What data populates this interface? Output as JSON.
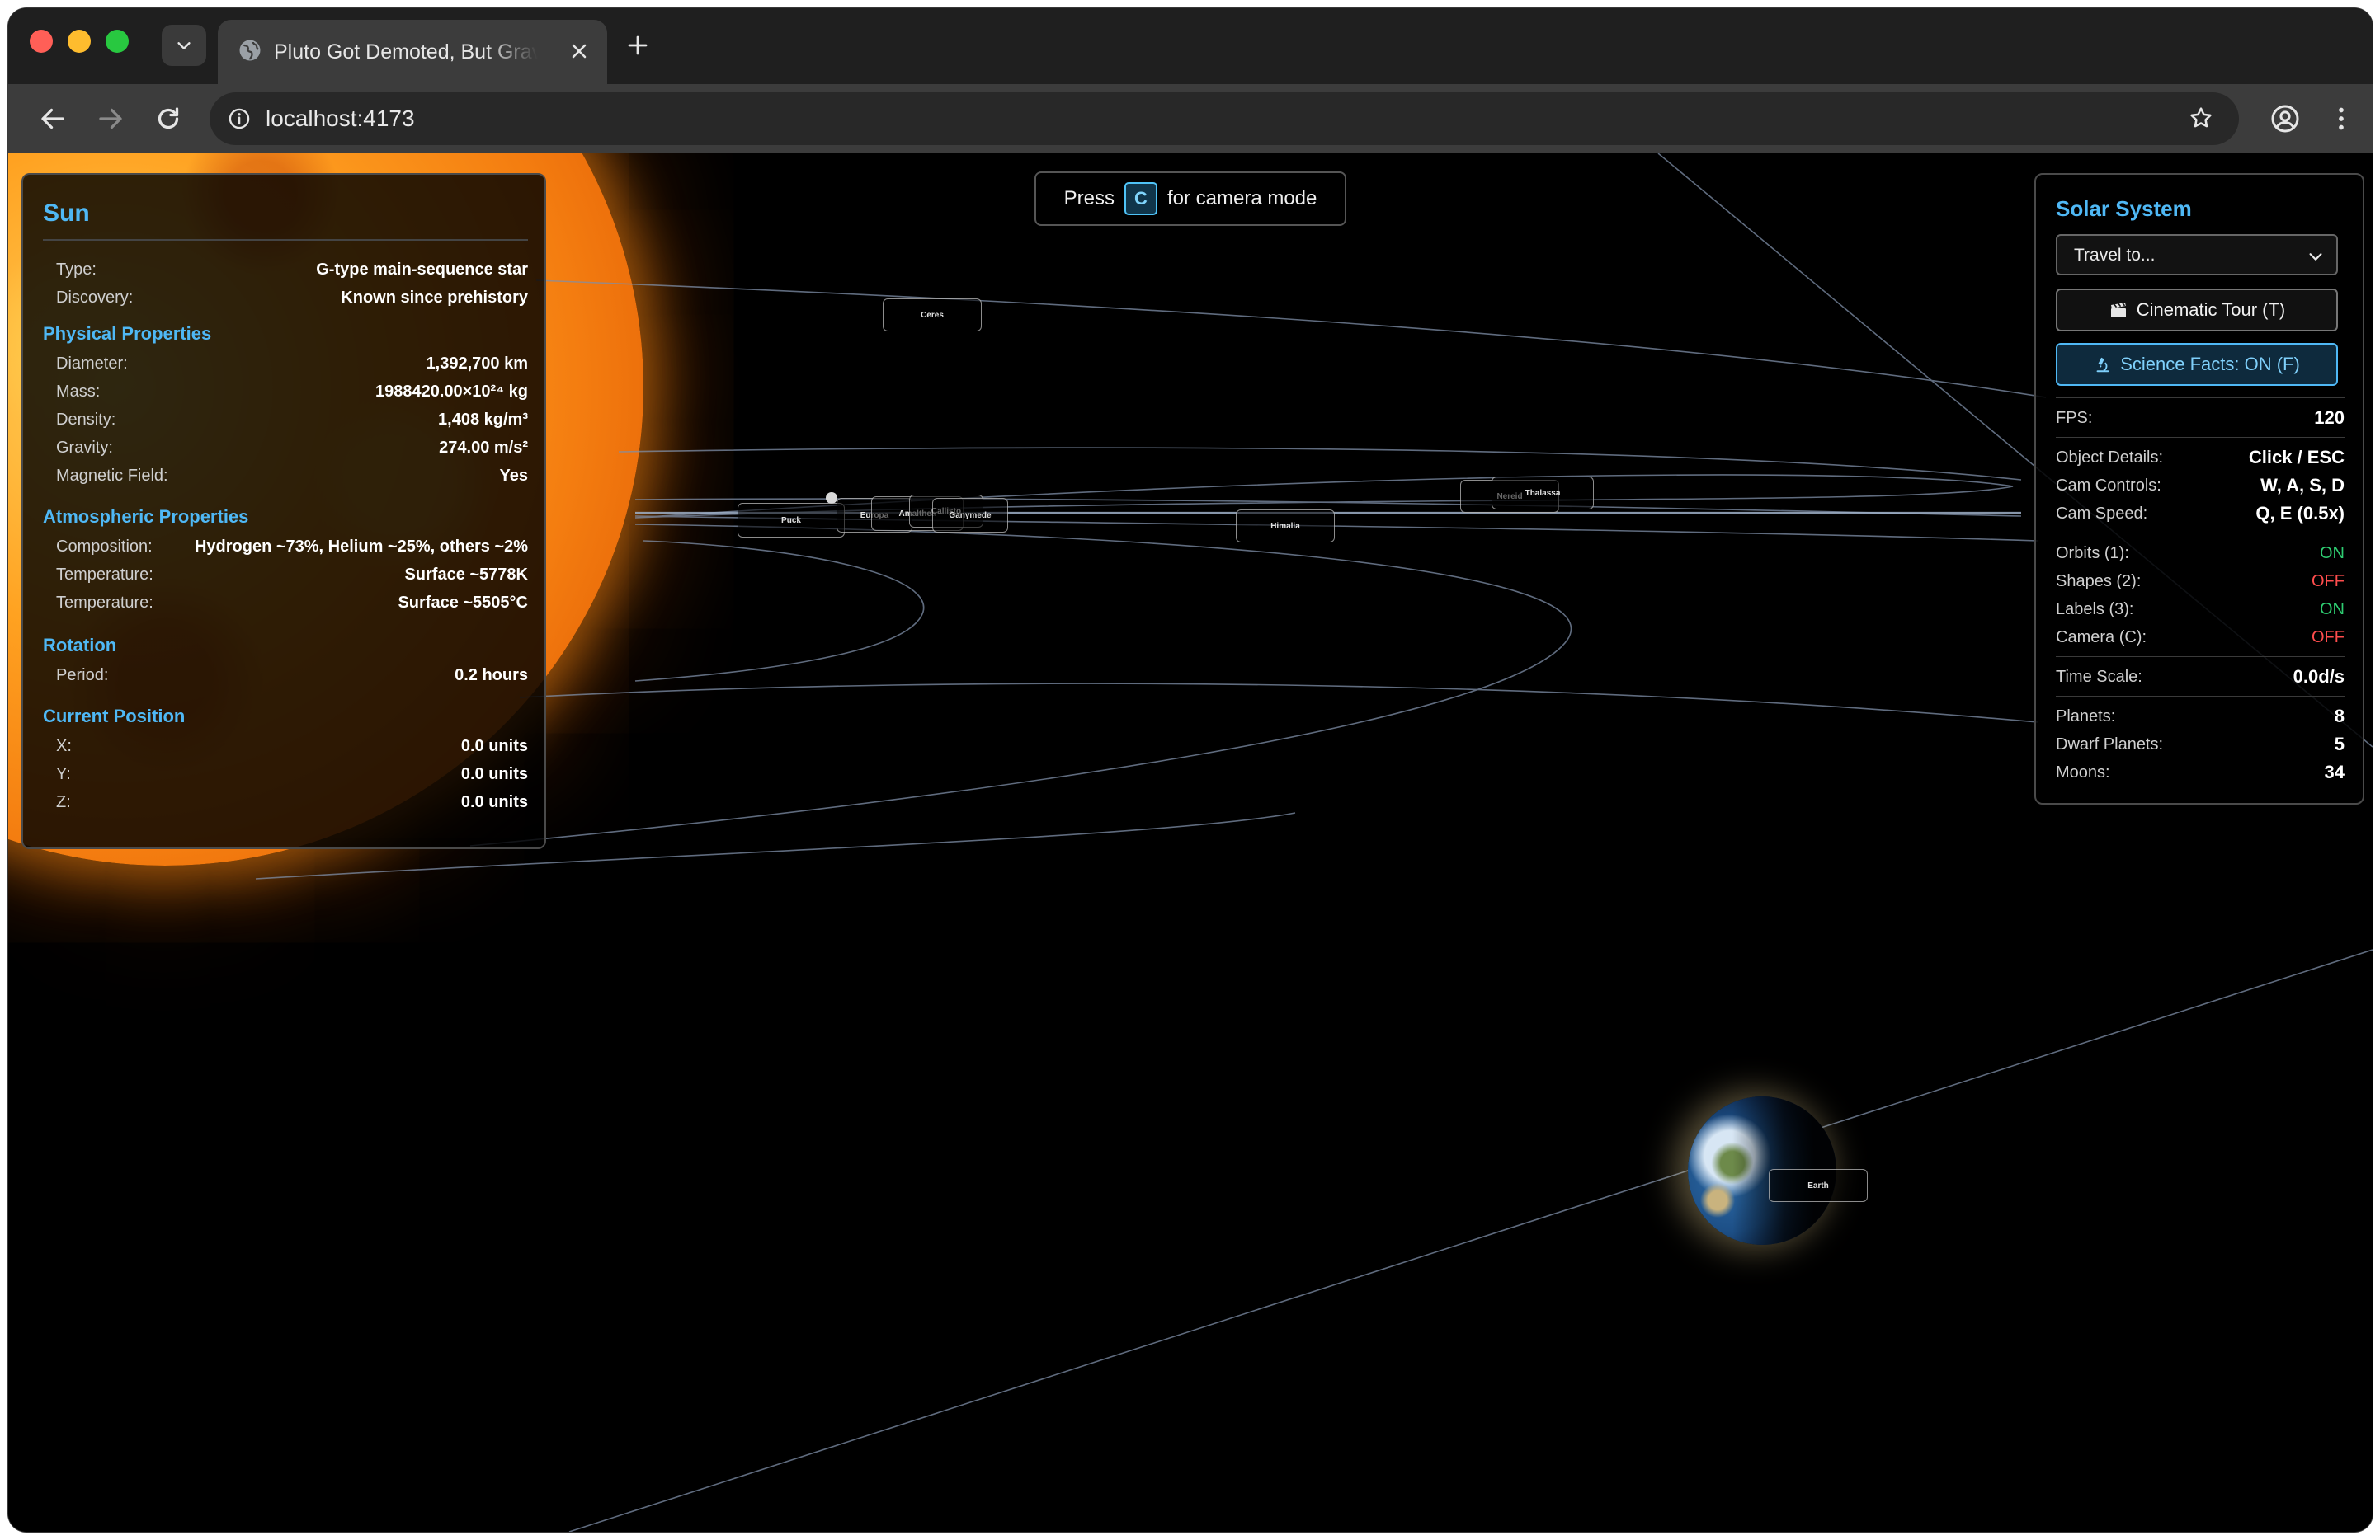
{
  "browser": {
    "tab_title": "Pluto Got Demoted, But Gravity Still Rules",
    "url": "localhost:4173"
  },
  "hint": {
    "press": "Press",
    "key": "C",
    "suffix": "for camera mode"
  },
  "labels": {
    "ceres": "Ceres",
    "puck": "Puck",
    "europa": "Europa",
    "amalthea": "Amalthea",
    "callisto": "Callisto",
    "ganymede": "Ganymede",
    "himalia": "Himalia",
    "nereid": "Nereid",
    "thalassa": "Thalassa",
    "earth": "Earth"
  },
  "info": {
    "title": "Sun",
    "type_label": "Type:",
    "type_value": "G-type main-sequence star",
    "discovery_label": "Discovery:",
    "discovery_value": "Known since prehistory",
    "physical": {
      "heading": "Physical Properties",
      "diameter_label": "Diameter:",
      "diameter_value": "1,392,700 km",
      "mass_label": "Mass:",
      "mass_value": "1988420.00×10²⁴ kg",
      "density_label": "Density:",
      "density_value": "1,408 kg/m³",
      "gravity_label": "Gravity:",
      "gravity_value": "274.00 m/s²",
      "magnetic_label": "Magnetic Field:",
      "magnetic_value": "Yes"
    },
    "atmosphere": {
      "heading": "Atmospheric Properties",
      "composition_label": "Composition:",
      "composition_value": "Hydrogen ~73%, Helium ~25%, others ~2%",
      "temp1_label": "Temperature:",
      "temp1_value": "Surface ~5778K",
      "temp2_label": "Temperature:",
      "temp2_value": "Surface ~5505°C"
    },
    "rotation": {
      "heading": "Rotation",
      "period_label": "Period:",
      "period_value": "0.2 hours"
    },
    "position": {
      "heading": "Current Position",
      "x_label": "X:",
      "x_value": "0.0 units",
      "y_label": "Y:",
      "y_value": "0.0 units",
      "z_label": "Z:",
      "z_value": "0.0 units"
    }
  },
  "controls": {
    "title": "Solar System",
    "travel_placeholder": "Travel to...",
    "tour_button": "Cinematic Tour (T)",
    "facts_button": "Science Facts: ON (F)",
    "fps_label": "FPS:",
    "fps_value": "120",
    "details_label": "Object Details:",
    "details_value": "Click / ESC",
    "cam_controls_label": "Cam Controls:",
    "cam_controls_value": "W, A, S, D",
    "cam_speed_label": "Cam Speed:",
    "cam_speed_value": "Q, E (0.5x)",
    "orbits_label": "Orbits (1):",
    "orbits_value": "ON",
    "shapes_label": "Shapes (2):",
    "shapes_value": "OFF",
    "labels_label": "Labels (3):",
    "labels_value": "ON",
    "camera_label": "Camera (C):",
    "camera_value": "OFF",
    "timescale_label": "Time Scale:",
    "timescale_value": "0.0d/s",
    "planets_label": "Planets:",
    "planets_value": "8",
    "dwarf_label": "Dwarf Planets:",
    "dwarf_value": "5",
    "moons_label": "Moons:",
    "moons_value": "34"
  },
  "colors": {
    "accent": "#4fb8f5",
    "on": "#2ecc71",
    "off": "#ff4d4d"
  }
}
